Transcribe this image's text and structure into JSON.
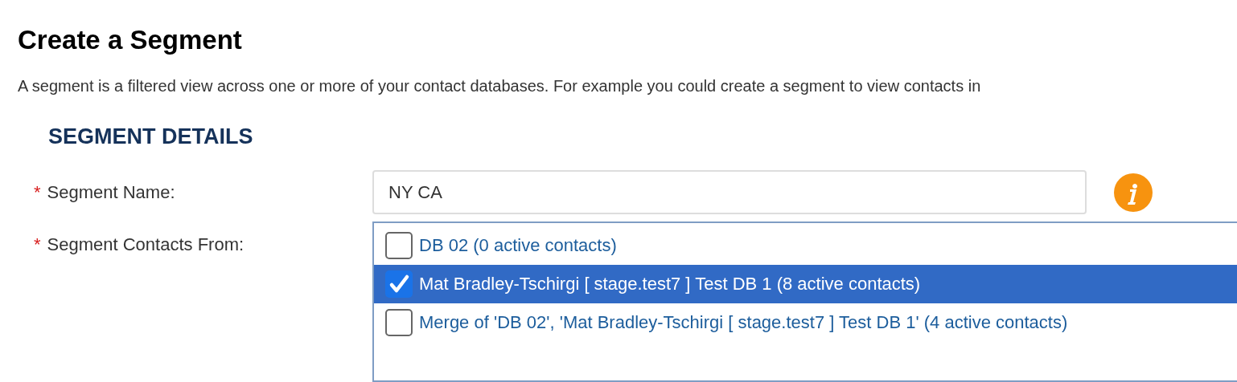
{
  "page": {
    "title": "Create a Segment",
    "description": "A segment is a filtered view across one or more of your contact databases. For example you could create a segment to view contacts in"
  },
  "section": {
    "heading": "SEGMENT DETAILS"
  },
  "fields": [
    {
      "kind": "text",
      "required_mark": "*",
      "label": "Segment Name:",
      "value": "NY CA",
      "info": true
    },
    {
      "kind": "checklist",
      "required_mark": "*",
      "label": "Segment Contacts From:",
      "options": [
        {
          "label": "DB 02 (0 active contacts)",
          "checked": false,
          "selected": false
        },
        {
          "label": "Mat Bradley-Tschirgi [ stage.test7 ] Test DB 1 (8 active contacts)",
          "checked": true,
          "selected": true
        },
        {
          "label": "Merge of 'DB 02', 'Mat Bradley-Tschirgi [ stage.test7 ] Test DB 1' (4 active contacts)",
          "checked": false,
          "selected": false
        }
      ]
    }
  ]
}
